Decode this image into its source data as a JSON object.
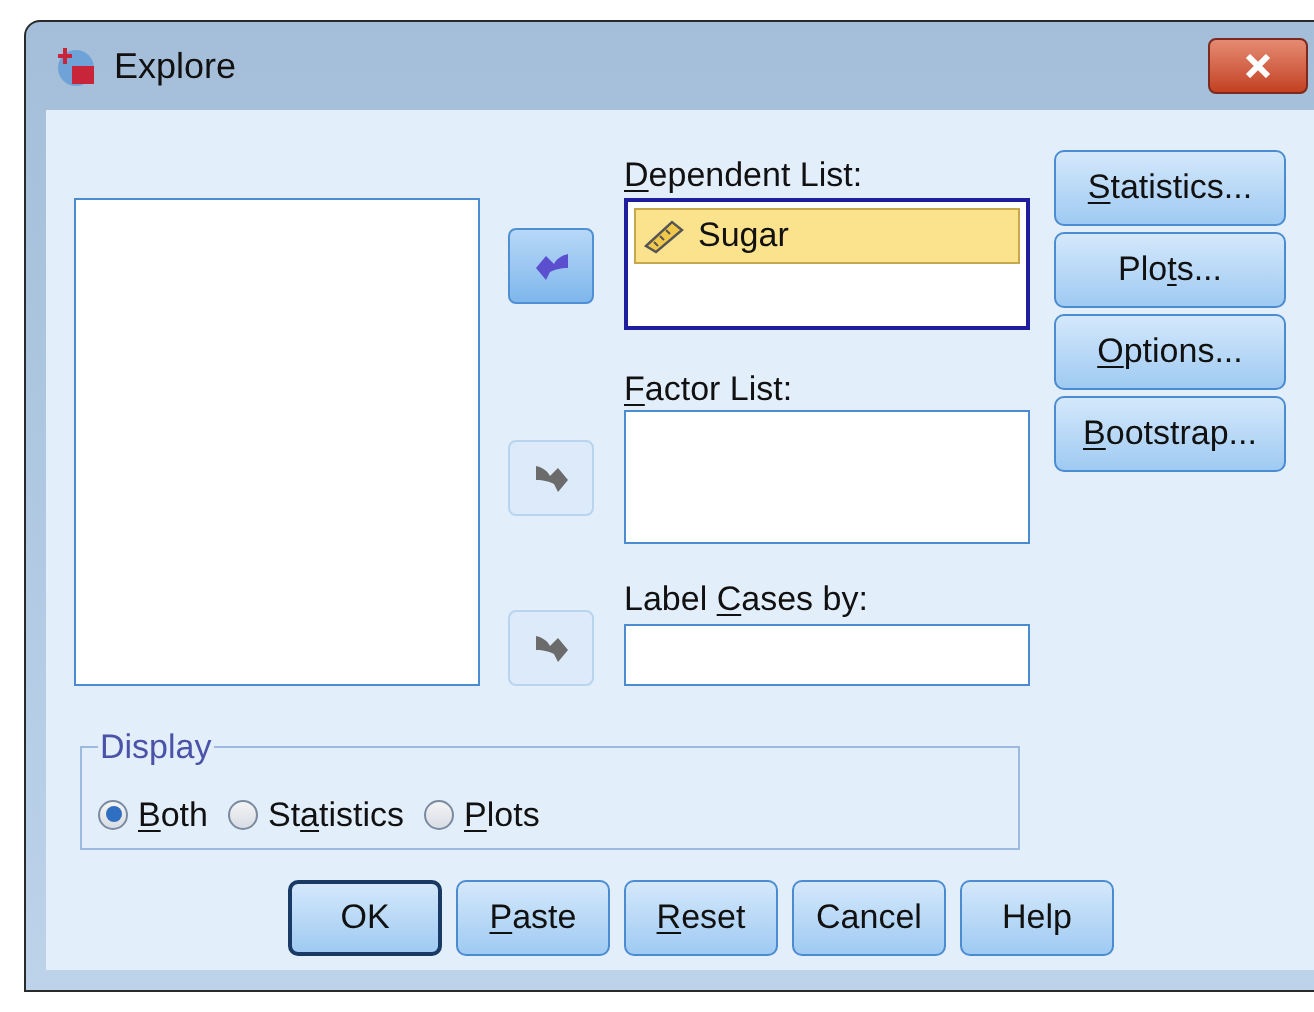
{
  "window": {
    "title": "Explore"
  },
  "arrow_buttons": [
    {
      "kind": "left",
      "disabled": false
    },
    {
      "kind": "right",
      "disabled": true
    },
    {
      "kind": "right",
      "disabled": true
    }
  ],
  "dependent_list": {
    "label": {
      "key": "D",
      "after": "ependent List:"
    },
    "items": [
      {
        "name": "Sugar",
        "selected": true
      }
    ]
  },
  "factor_list": {
    "label": {
      "key": "F",
      "after": "actor List:"
    }
  },
  "label_cases": {
    "label": {
      "before": "Label ",
      "key": "C",
      "after": "ases by:"
    }
  },
  "side_buttons": [
    {
      "label": {
        "key": "S",
        "after": "tatistics..."
      }
    },
    {
      "label": {
        "before": "Plo",
        "key": "t",
        "after": "s..."
      }
    },
    {
      "label": {
        "key": "O",
        "after": "ptions..."
      }
    },
    {
      "label": {
        "key": "B",
        "after": "ootstrap..."
      }
    }
  ],
  "display": {
    "legend": "Display",
    "options": [
      {
        "label": {
          "key": "B",
          "after": "oth"
        },
        "selected": true
      },
      {
        "label": {
          "before": "St",
          "key": "a",
          "after": "tistics"
        },
        "selected": false
      },
      {
        "label": {
          "key": "P",
          "after": "lots"
        },
        "selected": false
      }
    ]
  },
  "buttons": [
    {
      "label": {
        "after": "OK"
      },
      "default": true
    },
    {
      "label": {
        "key": "P",
        "after": "aste"
      },
      "default": false
    },
    {
      "label": {
        "key": "R",
        "after": "eset"
      },
      "default": false
    },
    {
      "label": {
        "after": "Cancel"
      },
      "default": false
    },
    {
      "label": {
        "after": "Help"
      },
      "default": false
    }
  ]
}
